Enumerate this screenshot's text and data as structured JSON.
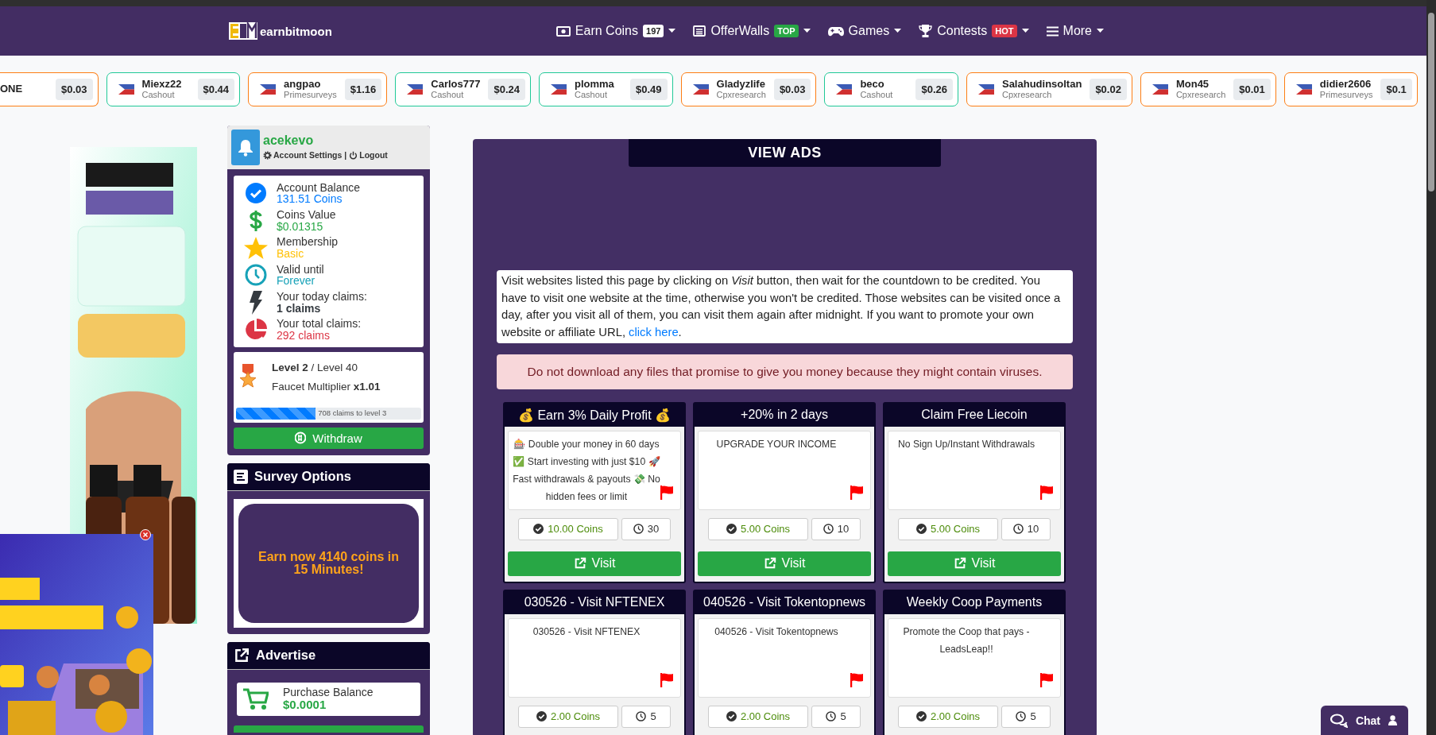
{
  "nav": {
    "brand": "earnbitmoon",
    "items": [
      {
        "label": "Earn Coins",
        "kind": "coins",
        "badge": {
          "text": "197",
          "color": "#ffffff"
        }
      },
      {
        "label": "OfferWalls",
        "kind": "list",
        "badge": {
          "text": "TOP",
          "color": "#28a745"
        }
      },
      {
        "label": "Games",
        "kind": "games"
      },
      {
        "label": "Contests",
        "kind": "trophy",
        "badge": {
          "text": "HOT",
          "color": "#dc3545"
        }
      },
      {
        "label": "More",
        "kind": "menu"
      }
    ]
  },
  "ticker": [
    {
      "name": "ONE",
      "amount": "$0.03",
      "color": "#fd7e14"
    },
    {
      "name": "Miexz22",
      "source": "Cashout",
      "amount": "$0.44",
      "color": "#20c997"
    },
    {
      "name": "angpao",
      "source": "Primesurveys",
      "amount": "$1.16",
      "color": "#fd7e14"
    },
    {
      "name": "Carlos777",
      "source": "Cashout",
      "amount": "$0.24",
      "color": "#20c997"
    },
    {
      "name": "plomma",
      "source": "Cashout",
      "amount": "$0.49",
      "color": "#20c997"
    },
    {
      "name": "Gladyzlife",
      "source": "Cpxresearch",
      "amount": "$0.03",
      "color": "#fd7e14"
    },
    {
      "name": "beco",
      "source": "Cashout",
      "amount": "$0.26",
      "color": "#20c997"
    },
    {
      "name": "Salahudinsoltan",
      "source": "Cpxresearch",
      "amount": "$0.02",
      "color": "#fd7e14"
    },
    {
      "name": "Mon45",
      "source": "Cpxresearch",
      "amount": "$0.01",
      "color": "#fd7e14"
    },
    {
      "name": "didier2606",
      "source": "Primesurveys",
      "amount": "$0.1",
      "color": "#fd7e14"
    }
  ],
  "account": {
    "username": "acekevo",
    "settings": "Account Settings",
    "separator": "|",
    "logout": "Logout"
  },
  "stats": [
    {
      "kind": "balance",
      "label": "Account Balance",
      "value": "131.51 Coins",
      "color": "#007bff"
    },
    {
      "kind": "value",
      "label": "Coins Value",
      "value": "$0.01315",
      "color": "#28a745"
    },
    {
      "kind": "membership",
      "label": "Membership",
      "value": "Basic",
      "color": "#ffc107"
    },
    {
      "kind": "validity",
      "label": "Valid until",
      "value": "Forever",
      "color": "#17a2b8"
    },
    {
      "kind": "today",
      "label": "Your today claims:",
      "value": "1 claims",
      "color": "#343a40"
    },
    {
      "kind": "total",
      "label": "Your total claims:",
      "value": "292 claims",
      "color": "#dc3545"
    }
  ],
  "level": {
    "current": "**Level 2** / Level 40",
    "multiplier": "Faucet Multiplier **x1.01**",
    "progress": {
      "level": 0.43,
      "label": "708 claims to level 3"
    }
  },
  "withdraw": "Withdraw",
  "survey": {
    "title": "Survey Options",
    "promo": "Earn now 4140 coins in 15 Minutes!"
  },
  "advertise": {
    "title": "Advertise",
    "purchase_label": "Purchase Balance",
    "purchase_value": "$0.0001"
  },
  "main": {
    "title": "VIEW ADS",
    "info": "Visit websites listed this page by clicking on *Visit* button, then wait for the countdown to be credited. You have to visit one website at the time, otherwise you won't be credited. Those websites can be visited once a day, after you visit all of them, you can visit them again after midnight. If you want to promote your own website or affiliate URL,",
    "info_link": "click here",
    "info_after": ".",
    "alert": "Do not download any files that promise to give you money because they might contain viruses.",
    "cards": [
      {
        "title": "💰 Earn 3% Daily Profit 💰",
        "description": "🎰 Double your money in 60 days ✅ Start investing with just $10 🚀 Fast withdrawals & payouts 💸 No hidden fees or limit",
        "coins": "10.00 Coins",
        "timer": "30",
        "button": "Visit"
      },
      {
        "title": "+20% in 2 days",
        "description": "UPGRADE YOUR INCOME",
        "coins": "5.00 Coins",
        "timer": "10",
        "button": "Visit"
      },
      {
        "title": "Claim Free Liecoin",
        "description": "No Sign Up/Instant Withdrawals",
        "coins": "5.00 Coins",
        "timer": "10",
        "button": "Visit"
      },
      {
        "title": "030526 - Visit NFTENEX",
        "description": "030526 - Visit NFTENEX",
        "coins": "2.00 Coins",
        "timer": "5"
      },
      {
        "title": "040526 - Visit Tokentopnews",
        "description": "040526 - Visit Tokentopnews",
        "coins": "2.00 Coins",
        "timer": "5"
      },
      {
        "title": "Weekly Coop Payments",
        "description": "Promote the Coop that pays - LeadsLeap!!",
        "coins": "2.00 Coins",
        "timer": "5"
      }
    ]
  },
  "chat": {
    "label": "Chat"
  }
}
